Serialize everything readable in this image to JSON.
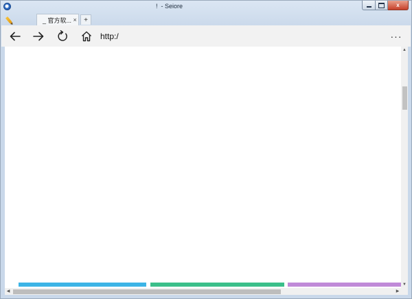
{
  "window": {
    "title": "!  - Seiore",
    "controls": {
      "close_label": "x"
    }
  },
  "tabs": {
    "active_label": "_ 官方软...",
    "close_glyph": "×",
    "new_tab_glyph": "+"
  },
  "nav": {
    "back_icon": "arrow-left-icon",
    "forward_icon": "arrow-right-icon",
    "refresh_icon": "refresh-icon",
    "home_icon": "home-icon",
    "address_value": "http:/",
    "more_label": "···"
  },
  "scroll": {
    "up_glyph": "▲",
    "down_glyph": "▼",
    "left_glyph": "◀",
    "right_glyph": "▶"
  },
  "colors": {
    "strip_blue": "#3cb4e6",
    "strip_green": "#3bbf8a",
    "strip_purple": "#c08ad8"
  }
}
